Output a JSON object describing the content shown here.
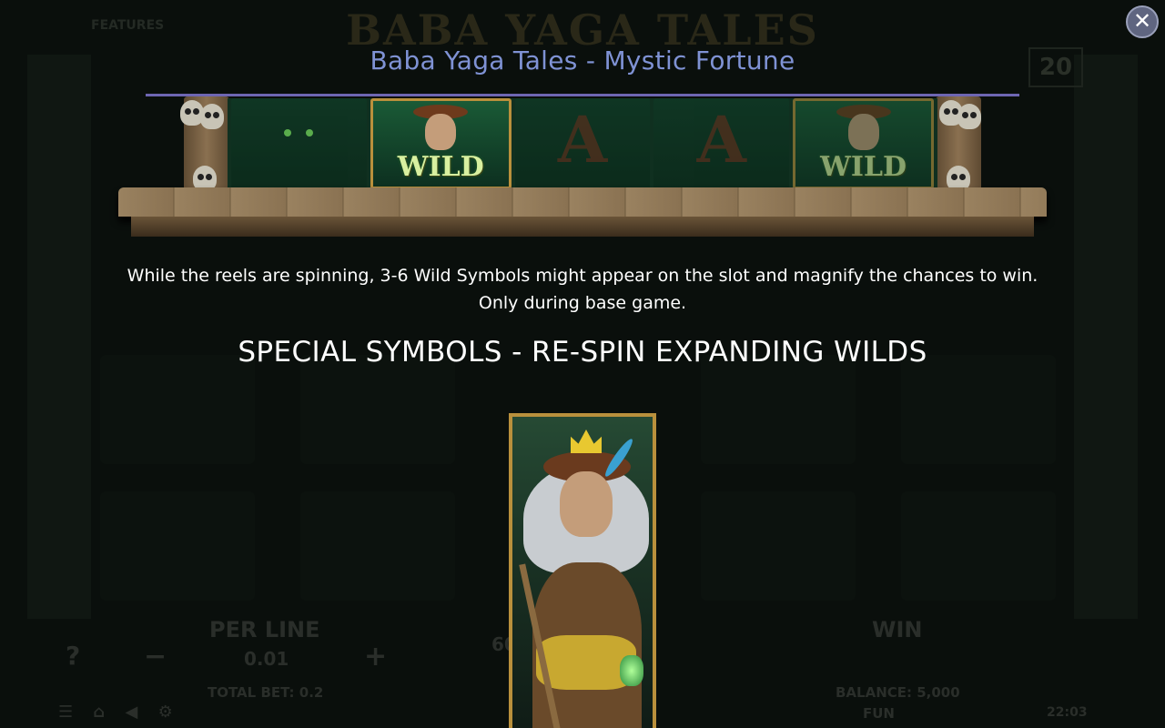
{
  "background": {
    "game_logo": "BABA YAGA TALES",
    "features_label": "FEATURES",
    "lines_count": "20",
    "per_line_label": "PER LINE",
    "per_line_value": "0.01",
    "total_bet": "TOTAL BET: 0.2",
    "win_label": "WIN",
    "balance": "BALANCE: 5,000",
    "mode": "FUN",
    "time": "22:03",
    "minus": "−",
    "plus": "+",
    "help": "?",
    "spin_hint": "60"
  },
  "overlay": {
    "title": "Baba Yaga Tales - Mystic Fortune",
    "close_icon": "close-icon",
    "reel_strip": {
      "cells": [
        "cat",
        "wild",
        "A",
        "A",
        "wild"
      ],
      "wild_label": "WILD"
    },
    "description": [
      "While the reels are spinning, 3-6 Wild Symbols might appear on the slot and magnify the chances to win.",
      "Only during base game."
    ],
    "section_title": "SPECIAL SYMBOLS - RE-SPIN EXPANDING WILDS",
    "expanding_wild_symbol": "baba-yaga-expanding-wild"
  },
  "colors": {
    "title": "#7f92d4",
    "rule": "#6e66b2",
    "symbol_frame": "#b9903c"
  }
}
